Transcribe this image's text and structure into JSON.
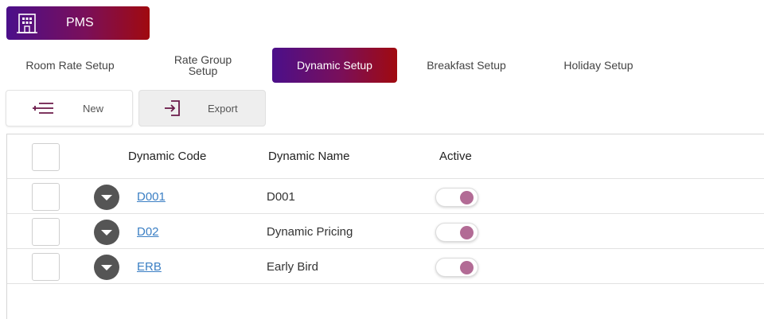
{
  "app": {
    "name": "PMS",
    "icon": "hotel-building-icon"
  },
  "tabs": [
    {
      "label": "Room Rate Setup",
      "active": false
    },
    {
      "label": "Rate Group\nSetup",
      "active": false
    },
    {
      "label": "Dynamic Setup",
      "active": true
    },
    {
      "label": "Breakfast Setup",
      "active": false
    },
    {
      "label": "Holiday Setup",
      "active": false
    }
  ],
  "toolbar": {
    "new_label": "New",
    "new_icon": "add-list-icon",
    "export_label": "Export",
    "export_icon": "export-icon"
  },
  "table": {
    "columns": [
      "Dynamic Code",
      "Dynamic Name",
      "Active"
    ],
    "rows": [
      {
        "code": "D001",
        "name": "D001",
        "active": true
      },
      {
        "code": "D02",
        "name": "Dynamic Pricing",
        "active": true
      },
      {
        "code": "ERB",
        "name": "Early Bird",
        "active": true
      }
    ]
  },
  "colors": {
    "gradient_start": "#4b0f8a",
    "gradient_end": "#a00a0f",
    "link": "#3b7fc4",
    "toggle_knob": "#b26b95",
    "expander": "#555555"
  }
}
